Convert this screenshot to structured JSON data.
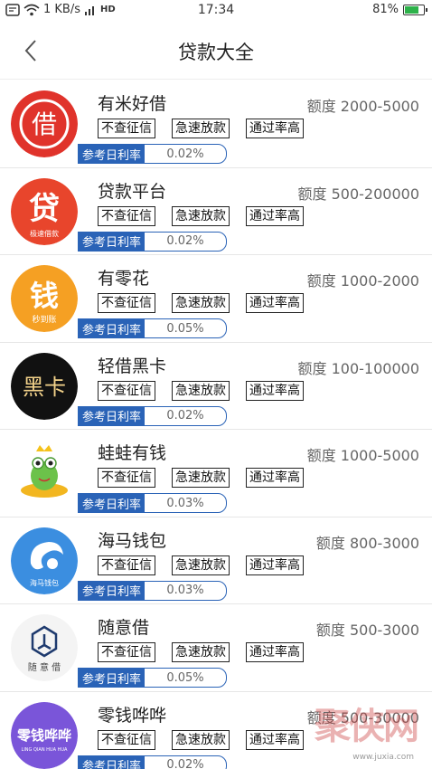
{
  "status_bar": {
    "network_speed": "1 KB/s",
    "volte": "HD",
    "time": "17:34",
    "battery": "81%",
    "battery_level": 0.81
  },
  "nav": {
    "title": "贷款大全"
  },
  "rate_label": "参考日利率",
  "items": [
    {
      "name": "有米好借",
      "amount": "额度 2000-5000",
      "tags": [
        "不查征信",
        "急速放款",
        "通过率高"
      ],
      "rate": "0.02%",
      "logo_text": "借",
      "logo_sub": "",
      "logo_color": "#e0332b"
    },
    {
      "name": "贷款平台",
      "amount": "额度 500-200000",
      "tags": [
        "不查征信",
        "急速放款",
        "通过率高"
      ],
      "rate": "0.02%",
      "logo_text": "贷",
      "logo_sub": "极速借款",
      "logo_color": "#e8452c"
    },
    {
      "name": "有零花",
      "amount": "额度 1000-2000",
      "tags": [
        "不查征信",
        "急速放款",
        "通过率高"
      ],
      "rate": "0.05%",
      "logo_text": "钱",
      "logo_sub": "秒到账",
      "logo_color": "#f5a023"
    },
    {
      "name": "轻借黑卡",
      "amount": "额度 100-100000",
      "tags": [
        "不查征信",
        "急速放款",
        "通过率高"
      ],
      "rate": "0.02%",
      "logo_text": "黑卡",
      "logo_sub": "",
      "logo_color": "#111111"
    },
    {
      "name": "蛙蛙有钱",
      "amount": "额度 1000-5000",
      "tags": [
        "不查征信",
        "急速放款",
        "通过率高"
      ],
      "rate": "0.03%",
      "logo_text": "",
      "logo_sub": "",
      "logo_color": "#ffffff"
    },
    {
      "name": "海马钱包",
      "amount": "额度 800-3000",
      "tags": [
        "不查征信",
        "急速放款",
        "通过率高"
      ],
      "rate": "0.03%",
      "logo_text": "",
      "logo_sub": "海马钱包",
      "logo_color": "#3b8ee0"
    },
    {
      "name": "随意借",
      "amount": "额度 500-3000",
      "tags": [
        "不查征信",
        "急速放款",
        "通过率高"
      ],
      "rate": "0.05%",
      "logo_text": "",
      "logo_sub": "随 意 借",
      "logo_color": "#f4f4f4"
    },
    {
      "name": "零钱哗哗",
      "amount": "额度 500-30000",
      "tags": [
        "不查征信",
        "急速放款",
        "通过率高"
      ],
      "rate": "0.02%",
      "logo_text": "零钱哗哗",
      "logo_sub": "LING QIAN HUA HUA",
      "logo_color": "#7a55d9"
    }
  ],
  "watermark": {
    "text": "聚侠网",
    "url": "www.juxia.com"
  },
  "colors": {
    "rate_blue": "#2a63b7"
  }
}
